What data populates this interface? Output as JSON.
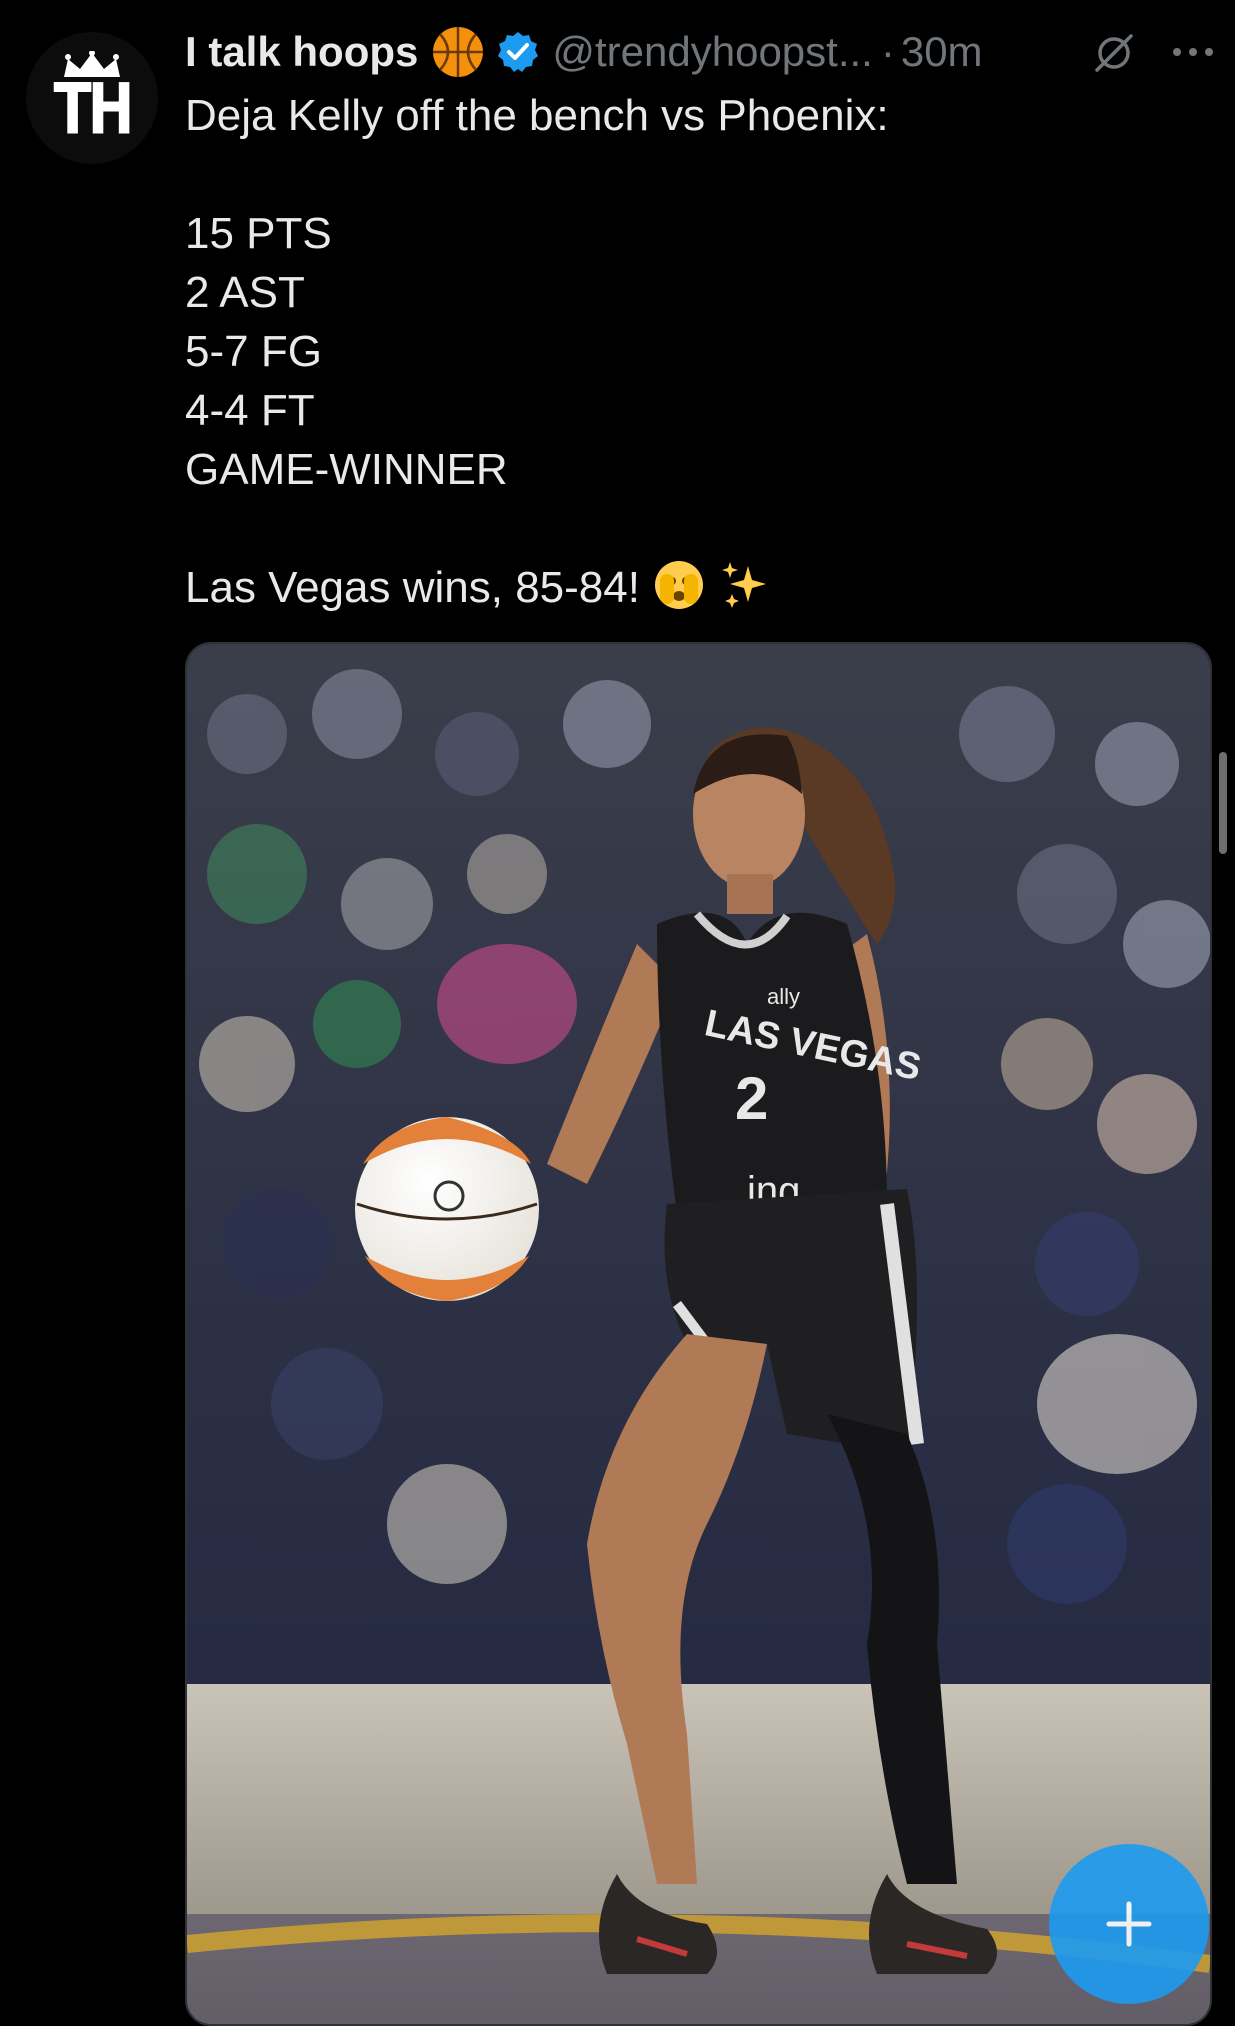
{
  "author": {
    "avatar_initials": "TH",
    "display_name": "I talk hoops",
    "name_emoji": "basketball-emoji",
    "verified": true,
    "handle": "@trendyhoopst...",
    "separator": "·",
    "time": "30m"
  },
  "tweet": {
    "lines": [
      "Deja Kelly off the bench vs Phoenix:",
      "",
      "15 PTS",
      "2 AST",
      "5-7 FG",
      "4-4 FT",
      "GAME-WINNER",
      "",
      "Las Vegas wins, 85-84!"
    ],
    "trailing_emojis": [
      "face-with-peeking-eye-emoji",
      "sparkles-emoji"
    ]
  },
  "media": {
    "jersey_sponsor": "ally",
    "jersey_team": "LAS VEGAS",
    "jersey_number": "2",
    "jersey_bottom_text": "ing"
  },
  "actions": {
    "grok_icon": "grok-icon",
    "more_icon": "more-icon",
    "compose_icon": "plus-icon"
  },
  "colors": {
    "background": "#000000",
    "primary_text": "#e7e9ea",
    "secondary_text": "#71767b",
    "accent": "#1d9bf0"
  }
}
